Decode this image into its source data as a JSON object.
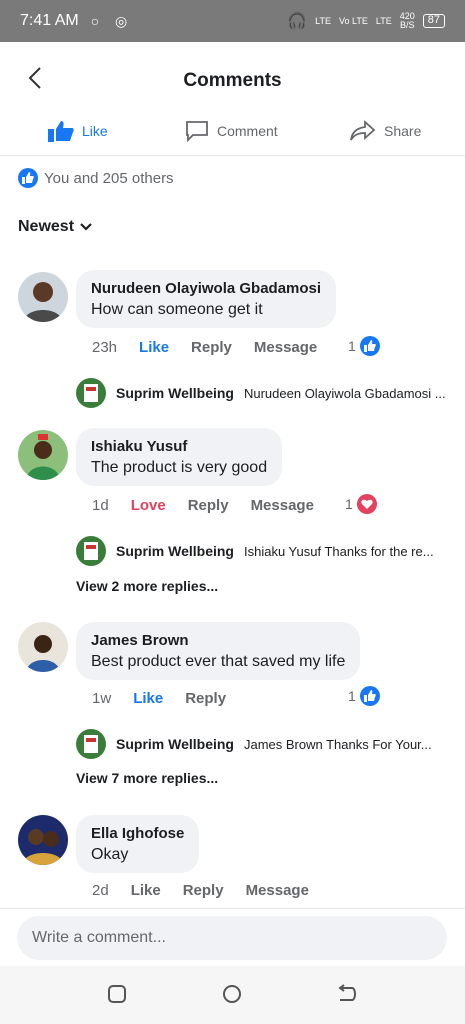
{
  "status": {
    "time": "7:41 AM",
    "speed": "420",
    "speed_unit": "B/S",
    "battery": "87",
    "net1": "LTE",
    "net2": "Vo LTE",
    "net3": "LTE"
  },
  "header": {
    "title": "Comments"
  },
  "actions": {
    "like": "Like",
    "comment": "Comment",
    "share": "Share"
  },
  "reactions": {
    "summary": "You and 205 others"
  },
  "sort": {
    "label": "Newest"
  },
  "comments": [
    {
      "name": "Nurudeen Olayiwola Gbadamosi",
      "text": "How can someone get it",
      "time": "23h",
      "reaction_label": "Like",
      "reply": "Reply",
      "message": "Message",
      "count": "1",
      "reply_preview": {
        "name": "Suprim Wellbeing",
        "text": "Nurudeen Olayiwola Gbadamosi ..."
      }
    },
    {
      "name": "Ishiaku Yusuf",
      "text": "The product is very good",
      "time": "1d",
      "reaction_label": "Love",
      "reply": "Reply",
      "message": "Message",
      "count": "1",
      "reply_preview": {
        "name": "Suprim Wellbeing",
        "text": "Ishiaku Yusuf Thanks for the re..."
      },
      "view_more": "View 2 more replies..."
    },
    {
      "name": "James Brown",
      "text": "Best product ever that saved my life",
      "time": "1w",
      "reaction_label": "Like",
      "reply": "Reply",
      "count": "1",
      "reply_preview": {
        "name": "Suprim Wellbeing",
        "text": "James Brown Thanks For Your..."
      },
      "view_more": "View 7 more replies..."
    },
    {
      "name": "Ella Ighofose",
      "text": "Okay",
      "time": "2d",
      "reaction_label": "Like",
      "reply": "Reply",
      "message": "Message"
    }
  ],
  "composer": {
    "placeholder": "Write a comment..."
  },
  "colors": {
    "accent": "#1877f2",
    "love": "#e4405f",
    "bubble": "#f0f2f5",
    "statusbar": "#7a7a7a"
  }
}
